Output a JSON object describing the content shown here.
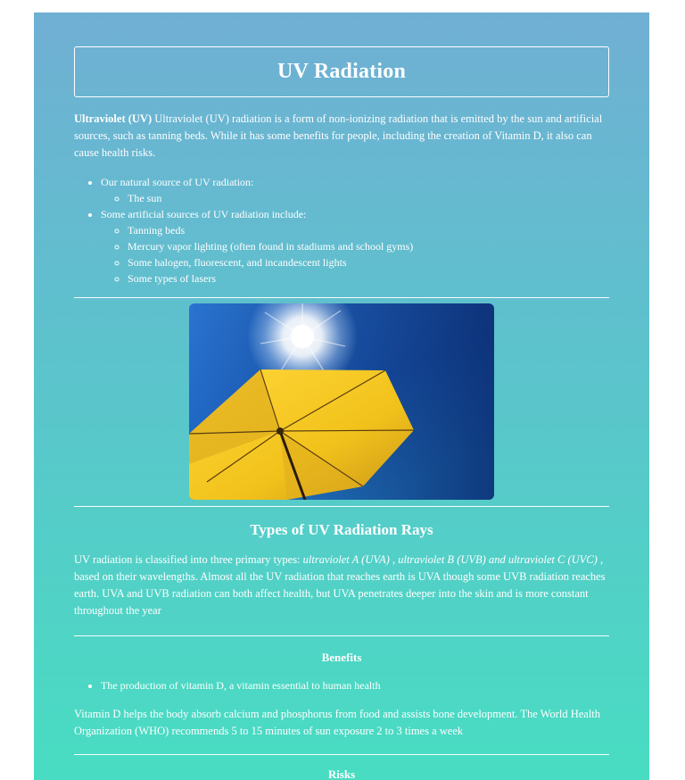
{
  "page": {
    "title": "UV Radiation"
  },
  "intro": {
    "lead_bold": "Ultraviolet (UV)",
    "text": " Ultraviolet (UV) radiation is a form of non-ionizing radiation that is emitted by the sun and artificial sources, such as tanning beds. While it has some benefits for people, including the creation of Vitamin D, it also can cause health risks."
  },
  "sources": {
    "natural_label": "Our natural source of UV radiation:",
    "natural_items": [
      "The sun"
    ],
    "artificial_label": "Some artificial sources of UV radiation include:",
    "artificial_items": [
      "Tanning beds",
      "Mercury vapor lighting (often found in stadiums and school gyms)",
      "Some halogen, fluorescent, and incandescent lights",
      "Some types of lasers"
    ]
  },
  "image": {
    "icon": "umbrella-sun-photo",
    "colors": {
      "sky_top": "#0a2a6e",
      "sky_mid": "#1f66c4",
      "sky_bottom": "#2a8fd6",
      "umbrella": "#f2c21b",
      "umbrella_shade": "#c9951a",
      "sun": "#ffffff"
    }
  },
  "types_section": {
    "heading": "Types of UV Radiation Rays",
    "text_before": "UV radiation is classified into three primary types: ",
    "text_italic": "ultraviolet A (UVA) , ultraviolet B (UVB) and ultraviolet C (UVC)",
    "text_after": " , based on their wavelengths. Almost all the UV radiation that reaches earth is UVA though some UVB radiation reaches earth. UVA and UVB radiation can both affect health, but UVA penetrates deeper into the skin and is more constant throughout the year"
  },
  "benefits": {
    "heading": "Benefits",
    "items": [
      "The production of vitamin D, a vitamin essential to human health"
    ],
    "text": "Vitamin D helps the body absorb calcium and phosphorus from food and assists bone development. The World Health Organization (WHO) recommends 5 to 15 minutes of sun exposure 2 to 3 times a week"
  },
  "risks": {
    "heading": "Risks"
  }
}
